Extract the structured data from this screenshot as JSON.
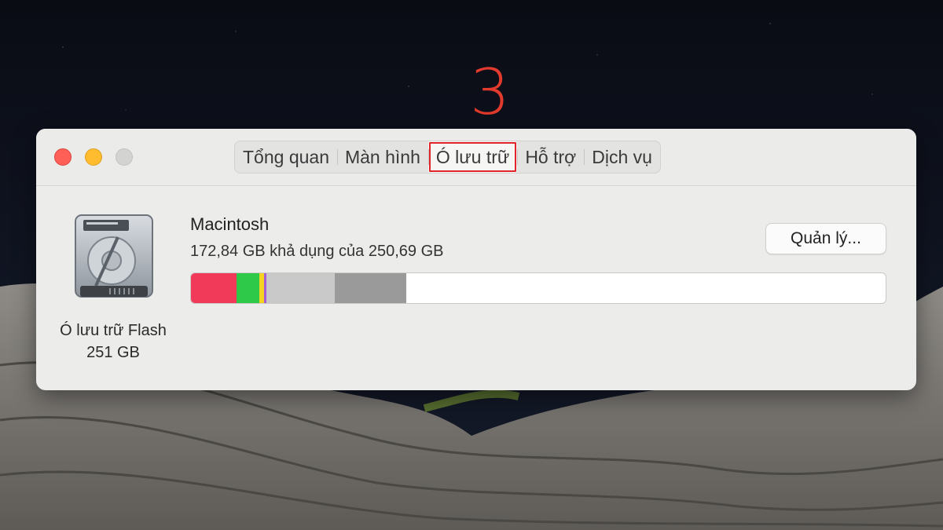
{
  "annotation": {
    "step_number": "3"
  },
  "window": {
    "tabs": [
      {
        "label": "Tổng quan",
        "active": false
      },
      {
        "label": "Màn hình",
        "active": false
      },
      {
        "label": "Ó lưu trữ",
        "active": true
      },
      {
        "label": "Hỗ trợ",
        "active": false
      },
      {
        "label": "Dịch vụ",
        "active": false
      }
    ],
    "drive": {
      "icon": "hard-drive-icon",
      "label_line1": "Ó lưu trữ Flash",
      "label_line2": "251 GB"
    },
    "volume": {
      "name": "Macintosh",
      "usage_text": "172,84 GB khả dụng của 250,69 GB",
      "manage_label": "Quản lý..."
    },
    "storage_bar": {
      "segments": [
        {
          "category": "segment-1",
          "fraction": 0.066,
          "color": "#f1395a"
        },
        {
          "category": "segment-2",
          "fraction": 0.032,
          "color": "#2fc94a"
        },
        {
          "category": "segment-3",
          "fraction": 0.007,
          "color": "#f6d321"
        },
        {
          "category": "segment-4",
          "fraction": 0.004,
          "color": "#a55fd6"
        },
        {
          "category": "segment-5",
          "fraction": 0.098,
          "color": "#c9c9c9"
        },
        {
          "category": "segment-6",
          "fraction": 0.103,
          "color": "#9a9a9a"
        }
      ],
      "free_color": "#ffffff"
    }
  },
  "colors": {
    "annotation_red": "#e23a2c",
    "close": "#fe5f57",
    "minimize": "#febc2e",
    "zoom_disabled": "#d3d3d2"
  }
}
